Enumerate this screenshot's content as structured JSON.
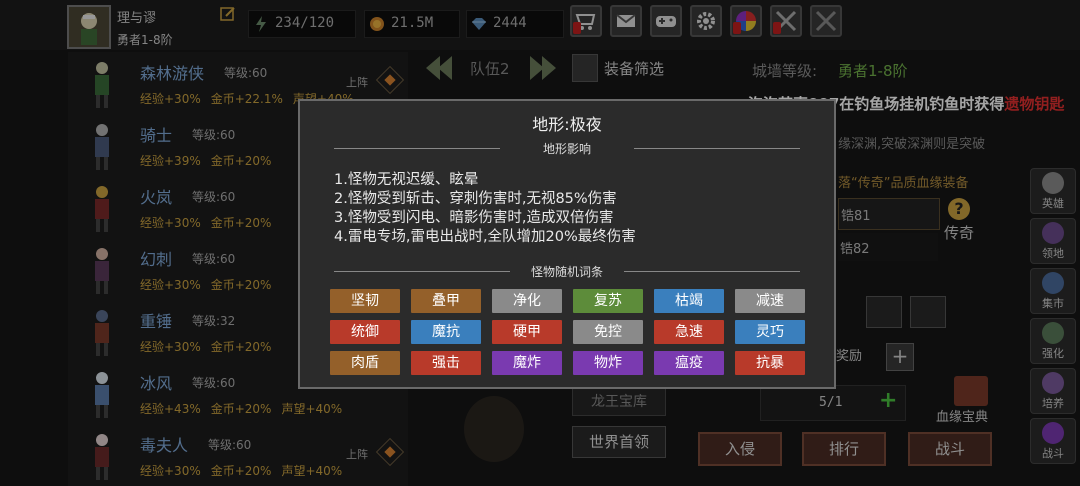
{
  "player": {
    "name": "理与谬",
    "title": "勇者1-8阶"
  },
  "resources": [
    {
      "name": "energy",
      "value": "234/120",
      "icon": "lightning-icon"
    },
    {
      "name": "gold",
      "value": "21.5M",
      "icon": "coin-icon"
    },
    {
      "name": "gems",
      "value": "2444",
      "icon": "diamond-icon"
    }
  ],
  "top_buttons": [
    "shop-cart-icon",
    "mail-icon",
    "gamepad-icon",
    "gear-icon",
    "color-wheel-icon",
    "crossed-swords-icon",
    "crossed-swords-icon-2"
  ],
  "heroes": [
    {
      "name": "森林游侠",
      "level": "等级:60",
      "stats": [
        "经验+30%",
        "金币+22.1%",
        "声望+40%"
      ],
      "deploy": "上阵"
    },
    {
      "name": "骑士",
      "level": "等级:60",
      "stats": [
        "经验+39%",
        "金币+20%"
      ],
      "deploy": ""
    },
    {
      "name": "火岚",
      "level": "等级:60",
      "stats": [
        "经验+30%",
        "金币+20%"
      ],
      "deploy": ""
    },
    {
      "name": "幻刺",
      "level": "等级:60",
      "stats": [
        "经验+30%",
        "金币+20%"
      ],
      "deploy": ""
    },
    {
      "name": "重锤",
      "level": "等级:32",
      "stats": [
        "经验+30%",
        "金币+20%"
      ],
      "deploy": ""
    },
    {
      "name": "冰风",
      "level": "等级:60",
      "stats": [
        "经验+43%",
        "金币+20%",
        "声望+40%"
      ],
      "deploy": ""
    },
    {
      "name": "毒夫人",
      "level": "等级:60",
      "stats": [
        "经验+30%",
        "金币+20%",
        "声望+40%"
      ],
      "deploy": "上阵"
    }
  ],
  "team": {
    "label": "队伍2",
    "filter": "装备筛选"
  },
  "wall": {
    "label": "城墙等级:",
    "value": "勇者1-8阶"
  },
  "marquee": {
    "text": "泡泡茶壶007在钓鱼场挂机钓鱼时获得",
    "highlight": "遗物钥匙"
  },
  "background_text": {
    "line1": "缘深渊,突破深渊则是突破",
    "line2": "落“传奇”品质血缘装备",
    "item1": "锆81",
    "item2": "锆82",
    "legend": "传奇",
    "reward": "奖励",
    "count": "5/1",
    "bloodline": "血缘宝典",
    "dragon": "龙王宝库",
    "world_boss": "世界首领"
  },
  "side_buttons": [
    "英雄",
    "领地",
    "集市",
    "强化",
    "培养",
    "战斗"
  ],
  "bottom_buttons": [
    "入侵",
    "排行",
    "战斗"
  ],
  "modal": {
    "title": "地形:极夜",
    "section1": "地形影响",
    "effects": [
      "1.怪物无视迟缓、眩晕",
      "2.怪物受到斩击、穿刺伤害时,无视85%伤害",
      "3.怪物受到闪电、暗影伤害时,造成双倍伤害",
      "4.雷电专场,雷电出战时,全队增加20%最终伤害"
    ],
    "section2": "怪物随机词条",
    "tags": [
      {
        "label": "坚韧",
        "color": "#94602a"
      },
      {
        "label": "叠甲",
        "color": "#94602a"
      },
      {
        "label": "净化",
        "color": "#8a8a8a"
      },
      {
        "label": "复苏",
        "color": "#5d8c3a"
      },
      {
        "label": "枯竭",
        "color": "#3a7fbd"
      },
      {
        "label": "减速",
        "color": "#8a8a8a"
      },
      {
        "label": "统御",
        "color": "#b83a2a"
      },
      {
        "label": "魔抗",
        "color": "#3a7fbd"
      },
      {
        "label": "硬甲",
        "color": "#b83a2a"
      },
      {
        "label": "免控",
        "color": "#8a8a8a"
      },
      {
        "label": "急速",
        "color": "#b83a2a"
      },
      {
        "label": "灵巧",
        "color": "#3a7fbd"
      },
      {
        "label": "肉盾",
        "color": "#94602a"
      },
      {
        "label": "强击",
        "color": "#b83a2a"
      },
      {
        "label": "魔炸",
        "color": "#7a3ab0"
      },
      {
        "label": "物炸",
        "color": "#7a3ab0"
      },
      {
        "label": "瘟疫",
        "color": "#7a3ab0"
      },
      {
        "label": "抗暴",
        "color": "#b83a2a"
      }
    ]
  }
}
